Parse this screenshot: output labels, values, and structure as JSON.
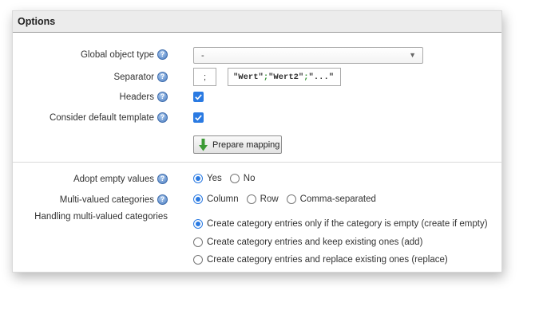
{
  "panel": {
    "title": "Options"
  },
  "fields": {
    "global_object_type": {
      "label": "Global object type",
      "value": "-"
    },
    "separator": {
      "label": "Separator",
      "value": ";",
      "example_parts": [
        "\"Wert\"",
        ";",
        "\"Wert2\"",
        ";",
        "\"...\""
      ]
    },
    "headers": {
      "label": "Headers",
      "checked": true
    },
    "default_template": {
      "label": "Consider default template",
      "checked": true
    },
    "prepare_button": {
      "label": "Prepare mapping"
    },
    "adopt_empty": {
      "label": "Adopt empty values",
      "options": [
        "Yes",
        "No"
      ],
      "selected": "Yes"
    },
    "multi_valued": {
      "label": "Multi-valued categories",
      "options": [
        "Column",
        "Row",
        "Comma-separated"
      ],
      "selected": "Column"
    },
    "handling": {
      "label": "Handling multi-valued categories",
      "options": [
        "Create category entries only if the category is empty (create if empty)",
        "Create category entries and keep existing ones (add)",
        "Create category entries and replace existing ones (replace)"
      ],
      "selected": 0
    }
  },
  "icons": {
    "help": "help-icon",
    "dropdown": "chevron-down-icon",
    "arrow": "arrow-down-icon"
  },
  "colors": {
    "accent": "#2a7ae2",
    "example_green": "#2f8f2f"
  }
}
